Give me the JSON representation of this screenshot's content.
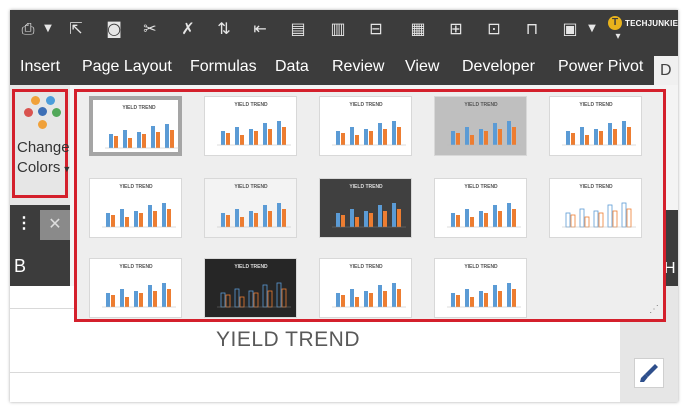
{
  "toolbar": {
    "icons": [
      "print-preview-icon",
      "dropdown-arrow-icon",
      "select-cursor-icon",
      "camera-icon",
      "cut-cells-icon",
      "clear-formats-icon",
      "sort-icon",
      "indent-icon",
      "chart-icon",
      "bar-chart-icon",
      "align-icon",
      "column-chart-icon",
      "distribute-icon",
      "split-icon",
      "paste-options-icon",
      "more-dropdown-icon"
    ]
  },
  "brand": {
    "letter": "T",
    "name": "TECHJUNKIE",
    "accent": "#e8b21c"
  },
  "ribbon": {
    "tabs": [
      "Insert",
      "Page Layout",
      "Formulas",
      "Data",
      "Review",
      "View",
      "Developer",
      "Power Pivot"
    ],
    "active_tab": "D"
  },
  "change_colors": {
    "label_line1": "Change",
    "label_line2": "Colors",
    "dot_colors": [
      "#f0a13a",
      "#4c9ddb",
      "#52a85a",
      "#d9534f",
      "#3d6fb6"
    ]
  },
  "formula_bar": {
    "expander": "⋮",
    "cancel_symbol": "✕"
  },
  "column_header": {
    "letter": "B",
    "right_letter": "H"
  },
  "sheet": {
    "chart_title": "YIELD TREND"
  },
  "gallery": {
    "highlight_color": "#d4202c",
    "styles": [
      {
        "title": "YIELD TREND",
        "bg": "#ffffff",
        "selected": true
      },
      {
        "title": "YIELD TREND",
        "bg": "#ffffff",
        "selected": false
      },
      {
        "title": "YIELD TREND",
        "bg": "#ffffff",
        "selected": false
      },
      {
        "title": "YIELD TREND",
        "bg": "#bfbfbf",
        "selected": false
      },
      {
        "title": "YIELD TREND",
        "bg": "#ffffff",
        "selected": false
      },
      {
        "title": "YIELD TREND",
        "bg": "#ffffff",
        "selected": false
      },
      {
        "title": "YIELD TREND",
        "bg": "#f3f3f3",
        "selected": false
      },
      {
        "title": "YIELD TREND",
        "bg": "#404040",
        "selected": false
      },
      {
        "title": "YIELD TREND",
        "bg": "#ffffff",
        "selected": false
      },
      {
        "title": "YIELD TREND",
        "bg": "#ffffff",
        "selected": false
      },
      {
        "title": "YIELD TREND",
        "bg": "#ffffff",
        "selected": false
      },
      {
        "title": "YIELD TREND",
        "bg": "#262626",
        "selected": false
      },
      {
        "title": "YIELD TREND",
        "bg": "#ffffff",
        "selected": false
      },
      {
        "title": "YIELD TREND",
        "bg": "#ffffff",
        "selected": false
      }
    ]
  },
  "series_colors": {
    "blue": "#5b9bd5",
    "orange": "#ed7d31"
  }
}
